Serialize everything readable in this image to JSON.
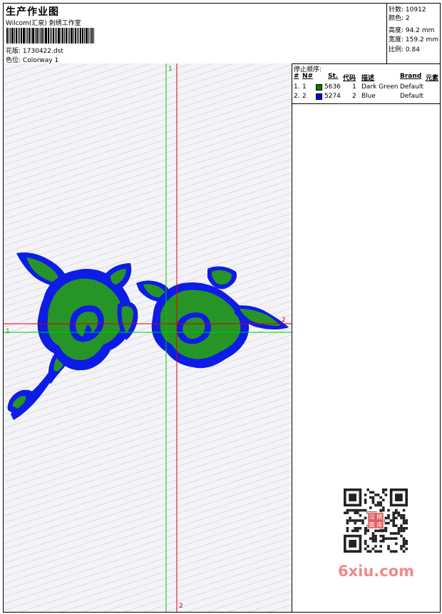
{
  "header": {
    "title": "生产作业图",
    "company": "Wilcom(汇泉) 刺绣工作室",
    "design_label": "花版:",
    "design_value": "1730422.dst",
    "colorway_label": "色位:",
    "colorway_value": "Colorway 1"
  },
  "stats": [
    {
      "label": "针数:",
      "value": "10912"
    },
    {
      "label": "颜色:",
      "value": "2"
    },
    {
      "label": "高度:",
      "value": "94.2 mm"
    },
    {
      "label": "宽度:",
      "value": "159.2 mm"
    },
    {
      "label": "比例:",
      "value": "0.84"
    }
  ],
  "stop_sequence": {
    "title": "停止顺序:",
    "columns": {
      "num": "#",
      "needle": "N#",
      "stitches": "St.",
      "code": "代码",
      "desc": "描述",
      "brand": "Brand",
      "element": "元素"
    },
    "rows": [
      {
        "num": "1.",
        "needle": "1",
        "stitches": "5636",
        "code": "1",
        "desc": "Dark Green",
        "brand": "Default",
        "color": "#008000"
      },
      {
        "num": "2.",
        "needle": "2",
        "stitches": "5274",
        "code": "2",
        "desc": "Blue",
        "brand": "Default",
        "color": "#0000ff"
      }
    ]
  },
  "axes": {
    "v_green": "1",
    "h_green": "1",
    "h_red": "2",
    "v_red": "2"
  },
  "colors": {
    "thread_green": "#1e8c1e",
    "thread_blue": "#0a14e6",
    "axis_green": "#00cc00",
    "axis_red": "#dd0000"
  },
  "watermark": "6xiu.com",
  "qr_badge": [
    "汉",
    "绣",
    "图",
    "库"
  ]
}
